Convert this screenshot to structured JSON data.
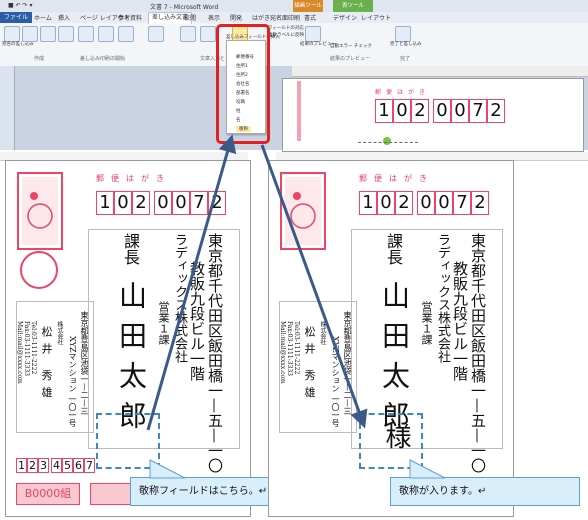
{
  "ribbon": {
    "title": "文書 7 - Microsoft Word",
    "context_tab_label": "描画ツール",
    "context_tab2_label": "表ツール",
    "tabs": [
      "ファイル",
      "ホーム",
      "挿入",
      "ページ レイアウト",
      "参考資料",
      "差し込み文書",
      "校閲",
      "表示",
      "開発",
      "はがき宛名面印刷",
      "書式",
      "デザイン",
      "レイアウト"
    ],
    "button_labels": [
      "宛名の差し込み",
      "宛名の並べ替え",
      "宛名を編集",
      "差し込み印刷の開始",
      "宛先の選択",
      "アドレス帳の編集",
      "差し込みフィールドの強調表示",
      "住所ブロック",
      "挨拶文",
      "差し込みフィールドの挿入",
      "フィールドの対応",
      "複数ラベルに反映",
      "結果のプレビュー",
      "エラーチェック",
      "完了と差し込み"
    ],
    "small_items": [
      "フィールドの対応",
      "複数ラベルに反映",
      "結果のプレビュー",
      "自動エラー チェック"
    ],
    "groups": [
      "作成",
      "差し込み印刷の開始",
      "文章入力と",
      "結果のプレビュー",
      "完了"
    ]
  },
  "dropdown": {
    "items": [
      "郵便番号",
      "住所1",
      "住所2",
      "会社名",
      "部署名",
      "役職",
      "姓",
      "名",
      "敬称"
    ]
  },
  "card": {
    "postcard_label": "郵便はがき",
    "zip_digits": [
      "1",
      "0",
      "2",
      "0",
      "0",
      "7",
      "2"
    ],
    "address_line1": "東京都千代田区飯田橋一—五—一〇",
    "address_line2": "教販九段ビル一階",
    "company": "ラディックス株式会社",
    "department": "営業１課",
    "position": "課長",
    "surname": "山田",
    "given_name": "太郎",
    "honorific": "様",
    "sender_address": "東京都豊島区池袋一—二—三",
    "sender_building": "XYZマンション 一〇一号",
    "sender_company": "株式会社",
    "sender_tel": "Tel:03-1111-2222",
    "sender_fax": "Fax:03-1111-3333",
    "sender_mail": "Mail:mail@xxxx.com",
    "sender_name": "松井 秀雄",
    "sender_zip": [
      "1",
      "2",
      "3",
      "4",
      "5",
      "6",
      "7"
    ],
    "lottery_label": "B0000組"
  },
  "callouts": {
    "left": "敬称フィールドはこちら。↵",
    "right": "敬称が入ります。↵"
  },
  "colors": {
    "accent": "#2c5ea8",
    "postal_red": "#e46",
    "highlight": "#e32020",
    "callout_fill": "#d9eefb",
    "arrow": "#3b5a8a"
  }
}
